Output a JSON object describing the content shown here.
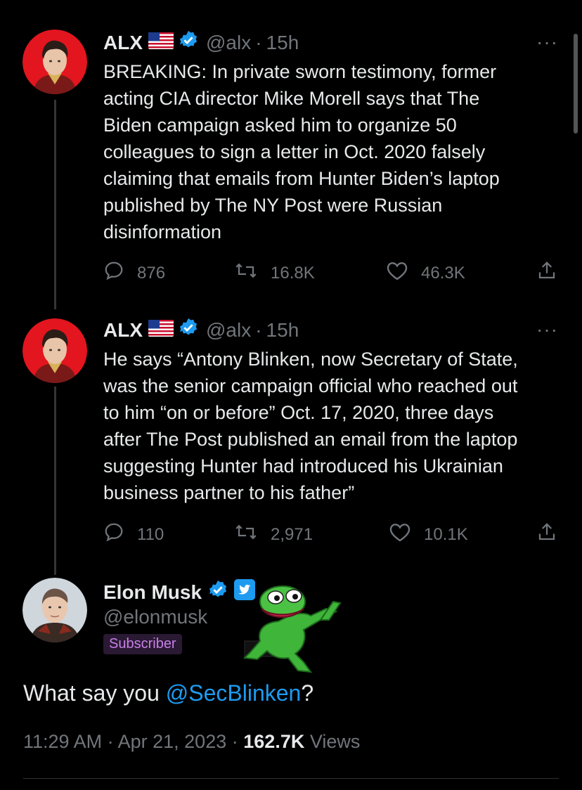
{
  "tweets": [
    {
      "name": "ALX",
      "handle": "@alx",
      "separator": "·",
      "time": "15h",
      "lines": [
        "BREAKING: In private sworn testimony, former",
        "acting CIA director Mike Morell says that The",
        "Biden campaign asked him to organize 50",
        "colleagues to sign a letter in Oct. 2020 falsely",
        "claiming that emails from Hunter Biden’s laptop",
        "published by The NY Post were Russian",
        "disinformation"
      ],
      "replies": "876",
      "retweets": "16.8K",
      "likes": "46.3K"
    },
    {
      "name": "ALX",
      "handle": "@alx",
      "separator": "·",
      "time": "15h",
      "lines": [
        "He says “Antony Blinken, now Secretary of State,",
        "was the senior campaign official who reached out",
        "to him “on or before” Oct. 17, 2020, three days",
        "after The Post published an email from the laptop",
        "suggesting Hunter had introduced his Ukrainian",
        "business partner to his father”"
      ],
      "replies": "110",
      "retweets": "2,971",
      "likes": "10.1K"
    }
  ],
  "main": {
    "name": "Elon Musk",
    "handle": "@elonmusk",
    "badge": "Subscriber",
    "text_before": "What say you ",
    "mention": "@SecBlinken",
    "text_after": "?",
    "time": "11:29 AM",
    "sep1": "·",
    "date": "Apr 21, 2023",
    "sep2": "·",
    "views_count": "162.7K",
    "views_label": "Views"
  },
  "more_label": "···",
  "colors": {
    "accent": "#1d9bf0",
    "verified_gold": "#1d9bf0",
    "badge": "#c780e8"
  }
}
